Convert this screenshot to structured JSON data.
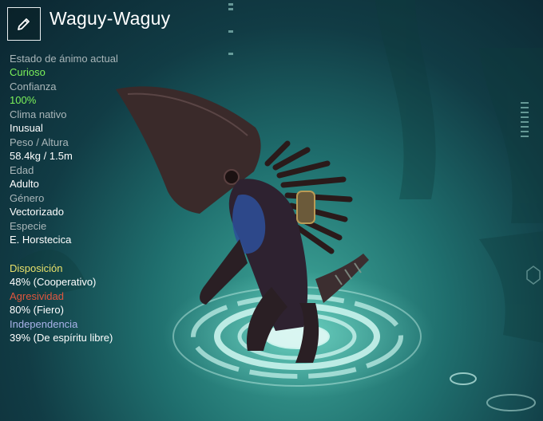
{
  "header": {
    "title": "Waguy-Waguy"
  },
  "stats": [
    {
      "label": "Estado de ánimo actual",
      "value": "Curioso"
    },
    {
      "label": "Confianza",
      "value": "100%"
    },
    {
      "label": "Clima nativo",
      "value": "Inusual"
    },
    {
      "label": "Peso / Altura",
      "value": "58.4kg / 1.5m"
    },
    {
      "label": "Edad",
      "value": "Adulto"
    },
    {
      "label": "Género",
      "value": "Vectorizado"
    },
    {
      "label": "Especie",
      "value": "E. Horstecica"
    }
  ],
  "traits": [
    {
      "label": "Disposición",
      "value": "48% (Cooperativo)",
      "color": "#e8e06a"
    },
    {
      "label": "Agresividad",
      "value": "80% (Fiero)",
      "color": "#e0563e"
    },
    {
      "label": "Independencia",
      "value": "39% (De espíritu libre)",
      "color": "#a9b3ea"
    }
  ],
  "colors": {
    "accent_value": "#7cf25a",
    "platform": "#c9f3ec"
  },
  "icons": {
    "edit": "pencil-icon"
  }
}
